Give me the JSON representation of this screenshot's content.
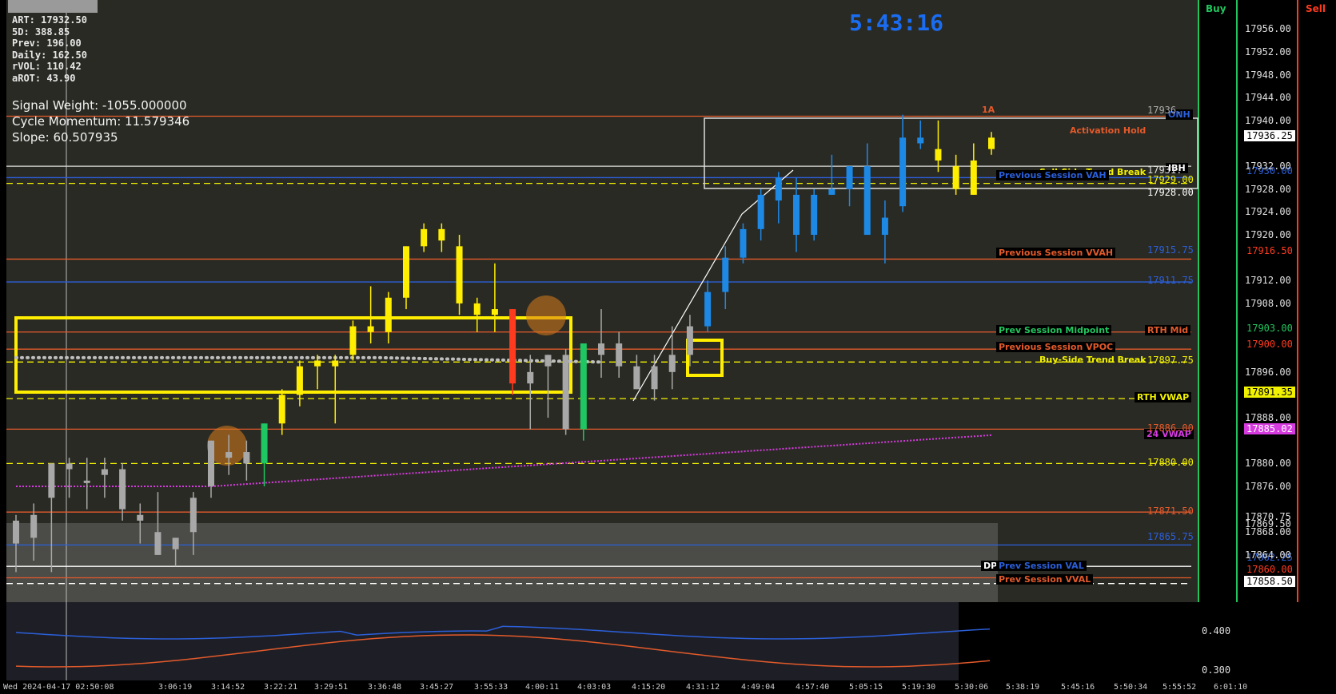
{
  "stats": {
    "art": "ART: 17932.50",
    "fived": "5D: 388.85",
    "prev": "Prev: 196.00",
    "daily": "Daily: 162.50",
    "rvol": "rVOL: 110.42",
    "arot": "aROT: 43.90"
  },
  "signals": {
    "weight": "Signal Weight: -1055.000000",
    "momentum": "Cycle Momentum: 11.579346",
    "slope": "Slope: 60.507935"
  },
  "clock": "5:43:16",
  "header": {
    "buy": "Buy",
    "sell": "Sell"
  },
  "colors": {
    "background": "#000000",
    "panel": "#2b2b26",
    "up": "#ffee00",
    "down": "#ffee00",
    "blue_candle": "#1e88e5",
    "green_candle": "#1fc763",
    "red_candle": "#ff3b1f",
    "gray_candle": "#a8a8a8",
    "vwap24": "#d63be0",
    "orange_line": "#e35a2b",
    "blue_line": "#2b5fd9",
    "yellow_dash": "#f2f200"
  },
  "chart_data": {
    "type": "candlestick",
    "y_axis": [
      "17956.00",
      "17952.00",
      "17948.00",
      "17944.00",
      "17940.00",
      "17936.25",
      "17932.00",
      "17928.00",
      "17924.00",
      "17920.00",
      "17916.50",
      "17912.00",
      "17908.00",
      "17903.00",
      "17900.00",
      "17896.00",
      "17891.35",
      "17888.00",
      "17885.02",
      "17880.00",
      "17876.00",
      "17870.75",
      "17869.50",
      "17868.00",
      "17864.00",
      "17862.25",
      "17860.00",
      "17858.50"
    ],
    "ylim": [
      17857,
      17958
    ],
    "x_axis": [
      "Wed 2024-04-17 02:50:08",
      "3:06:19",
      "3:14:52",
      "3:22:21",
      "3:29:51",
      "3:36:48",
      "3:45:27",
      "3:55:33",
      "4:00:11",
      "4:03:03",
      "4:15:20",
      "4:31:12",
      "4:49:04",
      "4:57:40",
      "5:05:15",
      "5:19:30",
      "5:30:06",
      "5:38:19",
      "5:45:16",
      "5:50:34",
      "5:55:52",
      "6:01:10"
    ],
    "candles": [
      {
        "o": 17866,
        "h": 17871,
        "l": 17861,
        "c": 17870,
        "col": "gray"
      },
      {
        "o": 17867,
        "h": 17873,
        "l": 17863,
        "c": 17871,
        "col": "gray"
      },
      {
        "o": 17874,
        "h": 17880,
        "l": 17861,
        "c": 17880,
        "col": "gray"
      },
      {
        "o": 17879,
        "h": 17881,
        "l": 17874,
        "c": 17880,
        "col": "gray"
      },
      {
        "o": 17877,
        "h": 17881,
        "l": 17872,
        "c": 17877,
        "col": "gray"
      },
      {
        "o": 17878,
        "h": 17881,
        "l": 17874,
        "c": 17879,
        "col": "gray"
      },
      {
        "o": 17879,
        "h": 17880,
        "l": 17870,
        "c": 17872,
        "col": "gray"
      },
      {
        "o": 17870,
        "h": 17873,
        "l": 17866,
        "c": 17871,
        "col": "gray"
      },
      {
        "o": 17868,
        "h": 17875,
        "l": 17865,
        "c": 17864,
        "col": "gray"
      },
      {
        "o": 17865,
        "h": 17867,
        "l": 17862,
        "c": 17867,
        "col": "gray"
      },
      {
        "o": 17868,
        "h": 17875,
        "l": 17864,
        "c": 17874,
        "col": "gray"
      },
      {
        "o": 17876,
        "h": 17884,
        "l": 17874,
        "c": 17884,
        "col": "gray"
      },
      {
        "o": 17882,
        "h": 17885,
        "l": 17878,
        "c": 17881,
        "col": "gray"
      },
      {
        "o": 17880,
        "h": 17884,
        "l": 17877,
        "c": 17882,
        "col": "gray"
      },
      {
        "o": 17880,
        "h": 17887,
        "l": 17876,
        "c": 17887,
        "col": "green"
      },
      {
        "o": 17887,
        "h": 17893,
        "l": 17885,
        "c": 17892,
        "col": "yellow"
      },
      {
        "o": 17892,
        "h": 17898,
        "l": 17890,
        "c": 17897,
        "col": "yellow"
      },
      {
        "o": 17897,
        "h": 17899,
        "l": 17893,
        "c": 17898,
        "col": "yellow"
      },
      {
        "o": 17898,
        "h": 17899,
        "l": 17887,
        "c": 17897,
        "col": "yellow"
      },
      {
        "o": 17899,
        "h": 17905,
        "l": 17898,
        "c": 17904,
        "col": "yellow"
      },
      {
        "o": 17903,
        "h": 17911,
        "l": 17901,
        "c": 17904,
        "col": "yellow"
      },
      {
        "o": 17903,
        "h": 17910,
        "l": 17901,
        "c": 17909,
        "col": "yellow"
      },
      {
        "o": 17909,
        "h": 17917,
        "l": 17907,
        "c": 17918,
        "col": "yellow"
      },
      {
        "o": 17918,
        "h": 17922,
        "l": 17917,
        "c": 17921,
        "col": "yellow"
      },
      {
        "o": 17921,
        "h": 17922,
        "l": 17917,
        "c": 17919,
        "col": "yellow"
      },
      {
        "o": 17918,
        "h": 17920,
        "l": 17906,
        "c": 17908,
        "col": "yellow"
      },
      {
        "o": 17908,
        "h": 17909,
        "l": 17903,
        "c": 17906,
        "col": "yellow"
      },
      {
        "o": 17906,
        "h": 17915,
        "l": 17903,
        "c": 17907,
        "col": "yellow"
      },
      {
        "o": 17907,
        "h": 17904,
        "l": 17892,
        "c": 17894,
        "col": "red"
      },
      {
        "o": 17894,
        "h": 17899,
        "l": 17886,
        "c": 17896,
        "col": "gray"
      },
      {
        "o": 17897,
        "h": 17899,
        "l": 17888,
        "c": 17899,
        "col": "gray"
      },
      {
        "o": 17899,
        "h": 17900,
        "l": 17885,
        "c": 17886,
        "col": "gray"
      },
      {
        "o": 17886,
        "h": 17900,
        "l": 17884,
        "c": 17901,
        "col": "green"
      },
      {
        "o": 17899,
        "h": 17907,
        "l": 17895,
        "c": 17901,
        "col": "gray"
      },
      {
        "o": 17901,
        "h": 17903,
        "l": 17895,
        "c": 17897,
        "col": "gray"
      },
      {
        "o": 17897,
        "h": 17899,
        "l": 17893,
        "c": 17893,
        "col": "gray"
      },
      {
        "o": 17893,
        "h": 17899,
        "l": 17891,
        "c": 17897,
        "col": "gray"
      },
      {
        "o": 17896,
        "h": 17904,
        "l": 17893,
        "c": 17899,
        "col": "gray"
      },
      {
        "o": 17899,
        "h": 17906,
        "l": 17897,
        "c": 17904,
        "col": "gray"
      },
      {
        "o": 17904,
        "h": 17912,
        "l": 17903,
        "c": 17910,
        "col": "blue"
      },
      {
        "o": 17910,
        "h": 17918,
        "l": 17907,
        "c": 17916,
        "col": "blue"
      },
      {
        "o": 17916,
        "h": 17922,
        "l": 17915,
        "c": 17921,
        "col": "blue"
      },
      {
        "o": 17921,
        "h": 17928,
        "l": 17919,
        "c": 17927,
        "col": "blue"
      },
      {
        "o": 17926,
        "h": 17931,
        "l": 17922,
        "c": 17930,
        "col": "blue"
      },
      {
        "o": 17927,
        "h": 17930,
        "l": 17917,
        "c": 17920,
        "col": "blue"
      },
      {
        "o": 17920,
        "h": 17928,
        "l": 17919,
        "c": 17927,
        "col": "blue"
      },
      {
        "o": 17927,
        "h": 17934,
        "l": 17927,
        "c": 17928,
        "col": "blue"
      },
      {
        "o": 17928,
        "h": 17932,
        "l": 17925,
        "c": 17932,
        "col": "blue"
      },
      {
        "o": 17932,
        "h": 17936,
        "l": 17920,
        "c": 17920,
        "col": "blue"
      },
      {
        "o": 17920,
        "h": 17926,
        "l": 17915,
        "c": 17923,
        "col": "blue"
      },
      {
        "o": 17925,
        "h": 17941,
        "l": 17924,
        "c": 17937,
        "col": "blue"
      },
      {
        "o": 17937,
        "h": 17940,
        "l": 17935,
        "c": 17936,
        "col": "blue"
      },
      {
        "o": 17935,
        "h": 17940,
        "l": 17931,
        "c": 17933,
        "col": "yellow"
      },
      {
        "o": 17932,
        "h": 17934,
        "l": 17927,
        "c": 17928,
        "col": "yellow"
      },
      {
        "o": 17933,
        "h": 17936,
        "l": 17927,
        "c": 17927,
        "col": "yellow"
      },
      {
        "o": 17935,
        "h": 17938,
        "l": 17934,
        "c": 17937,
        "col": "yellow"
      }
    ],
    "levels": [
      {
        "name": "Previous Session VAH",
        "value": 17930.0,
        "color": "#2b5fd9"
      },
      {
        "name": "Previous Session VVAH",
        "value": 17915.75,
        "color": "#e35a2b"
      },
      {
        "name": "Prev Session Midpoint",
        "value": 17903.0,
        "color": "#22c55e"
      },
      {
        "name": "RTH Mid",
        "value": 17903.0,
        "color": "#e35a2b"
      },
      {
        "name": "Previous Session VPOC",
        "value": 17900.0,
        "color": "#e35a2b"
      },
      {
        "name": "Buy-Side Trend Break",
        "value": 17897.75,
        "color": "#f2f200"
      },
      {
        "name": "RTH VWAP",
        "value": 17891.35,
        "color": "#f2f200"
      },
      {
        "name": "24 VWAP",
        "value": 17885.02,
        "color": "#d63be0"
      },
      {
        "name": "Prev Session VAL",
        "value": 17862.25,
        "color": "#2b5fd9"
      },
      {
        "name": "Prev Session VVAL",
        "value": 17860.0,
        "color": "#e35a2b"
      },
      {
        "name": "ONH",
        "value": 17940.0,
        "color": "#2b5fd9"
      },
      {
        "name": "IBH",
        "value": 17931.0,
        "color": "#ffffff"
      },
      {
        "name": "DPH",
        "value": 17862.0,
        "color": "#ffffff"
      },
      {
        "name": "1A",
        "value": 17941.0,
        "color": "#e35a2b"
      }
    ],
    "oscillator": {
      "ticks": [
        "0.400",
        "0.300"
      ]
    }
  },
  "labels": {
    "prev_vah": "Previous Session VAH",
    "prev_vvah": "Previous Session VVAH",
    "prev_mid": "Prev Session Midpoint",
    "rth_mid": "RTH Mid",
    "prev_vpoc": "Previous Session VPOC",
    "buy_tb": "Buy-Side Trend Break",
    "rth_vwap": "RTH VWAP",
    "vwap24": "24 VWAP",
    "prev_val": "Prev Session VAL",
    "prev_vval": "Prev Session VVAL",
    "onh": "ONH",
    "ibh": "IBH",
    "dph": "DPH",
    "one_a": "1A",
    "activation": "Activation Hold",
    "sell_tb": "Sell-Side Trend Break"
  },
  "price_labels": {
    "p17936": "17936.",
    "p17931": "17931.",
    "p17929": "17929.00",
    "p17928": "17928.00",
    "p17915": "17915.75",
    "p17911": "17911.75",
    "p17897": "17897.75",
    "p17886": "17886.00",
    "p17880": "17880.00",
    "p17871": "17871.50",
    "p17865": "17865.75"
  },
  "axis_badges": {
    "current": "17936.25",
    "vah": "17930.00",
    "vvah": "17916.50",
    "mid": "17903.00",
    "vpoc": "17900.00",
    "rthvwap": "17891.35",
    "vwap24": "17885.02",
    "val": "17862.25",
    "vval": "17860.00",
    "low": "17858.50"
  }
}
